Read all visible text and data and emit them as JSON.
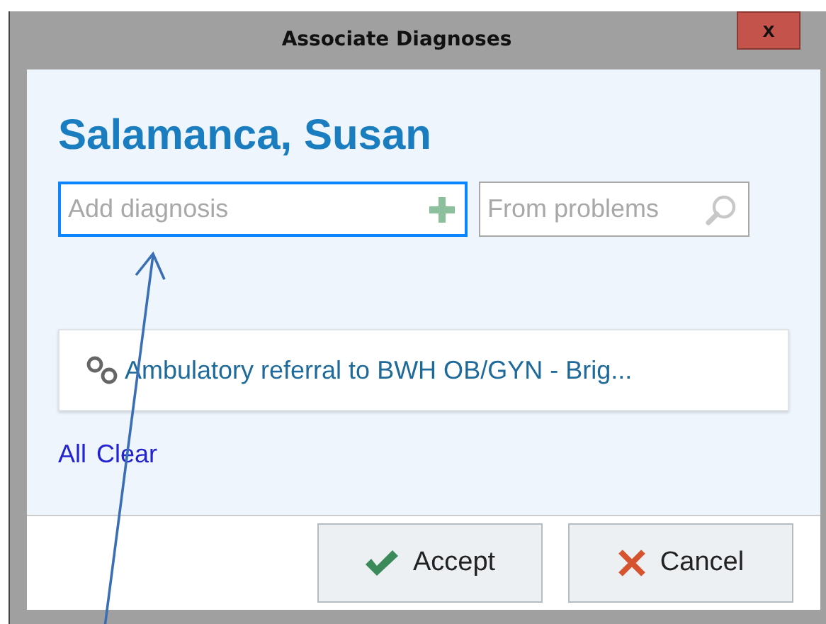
{
  "window": {
    "title": "Associate Diagnoses",
    "close_label": "x"
  },
  "patient_name": "Salamanca, Susan",
  "diagnosis_field": {
    "placeholder": "Add diagnosis",
    "focused": true
  },
  "problems_field": {
    "placeholder": "From problems"
  },
  "orders": [
    {
      "text": "Ambulatory referral to BWH OB/GYN - Brig..."
    }
  ],
  "links": [
    {
      "label": "All"
    },
    {
      "label": "Clear"
    }
  ],
  "buttons": [
    {
      "kind": "accept",
      "label": "Accept"
    },
    {
      "kind": "cancel",
      "label": "Cancel"
    }
  ],
  "annotation": {
    "kind": "arrow"
  }
}
